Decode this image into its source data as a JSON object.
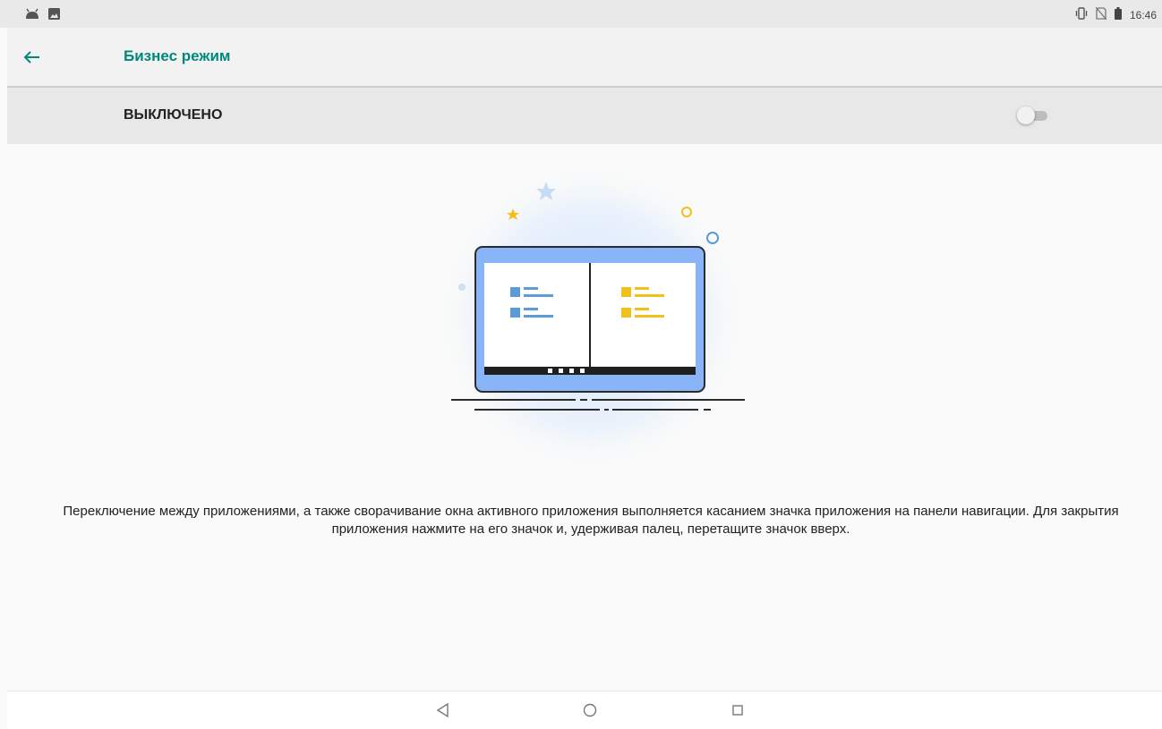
{
  "status_bar": {
    "left_icons": [
      "android-debug-icon",
      "image-notification-icon"
    ],
    "right_icons": [
      "vibrate-icon",
      "no-sim-icon",
      "battery-icon"
    ],
    "time": "16:46"
  },
  "app_bar": {
    "back_icon": "arrow-left-icon",
    "title": "Бизнес режим",
    "accent_color": "#00897b"
  },
  "master_switch": {
    "label": "ВЫКЛЮЧЕНО",
    "checked": false
  },
  "illustration": {
    "icon": "split-screen-tablet-icon",
    "colors": {
      "frame": "#8ab4f8",
      "left_pane": "#5a9bd8",
      "right_pane": "#f2c018"
    }
  },
  "description": "Переключение между приложениями, а также сворачивание окна активного приложения выполняется касанием значка приложения на панели навигации. Для закрытия приложения нажмите на его значок и, удерживая палец, перетащите значок вверх.",
  "nav_bar": {
    "icons": [
      "back-triangle-icon",
      "home-circle-icon",
      "recents-square-icon"
    ]
  }
}
